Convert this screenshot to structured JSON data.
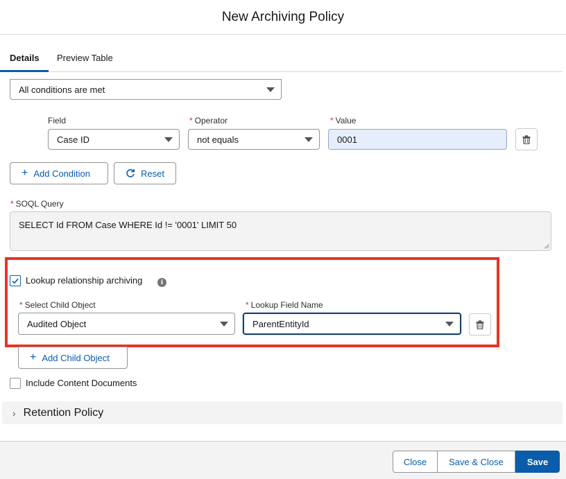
{
  "modal": {
    "title": "New Archiving Policy"
  },
  "tabs": [
    {
      "label": "Details",
      "active": true
    },
    {
      "label": "Preview Table",
      "active": false
    }
  ],
  "logic_select": {
    "value": "All conditions are met"
  },
  "condition": {
    "field_label": "Field",
    "field_value": "Case ID",
    "operator_label": "Operator",
    "operator_value": "not equals",
    "value_label": "Value",
    "value_value": "0001"
  },
  "buttons": {
    "add_condition": "Add Condition",
    "reset": "Reset",
    "add_child_object": "Add Child Object"
  },
  "soql": {
    "label": "SOQL Query",
    "value": "SELECT Id  FROM Case WHERE Id != '0001' LIMIT 50"
  },
  "lookup": {
    "checkbox_label": "Lookup relationship archiving",
    "checked": true,
    "child_object_label": "Select Child Object",
    "child_object_value": "Audited Object",
    "lookup_field_label": "Lookup Field Name",
    "lookup_field_value": "ParentEntityId"
  },
  "content_docs": {
    "label": "Include Content Documents",
    "checked": false
  },
  "accordion": {
    "title": "Retention Policy"
  },
  "footer": {
    "close": "Close",
    "save_close": "Save & Close",
    "save": "Save"
  },
  "colors": {
    "brand": "#0b5cab",
    "highlight": "#ea3323",
    "required": "#c23934"
  },
  "icons": [
    "trash-icon",
    "plus-icon",
    "refresh-icon",
    "check-icon",
    "info-icon",
    "chevron-right-icon",
    "chevron-down-icon"
  ]
}
